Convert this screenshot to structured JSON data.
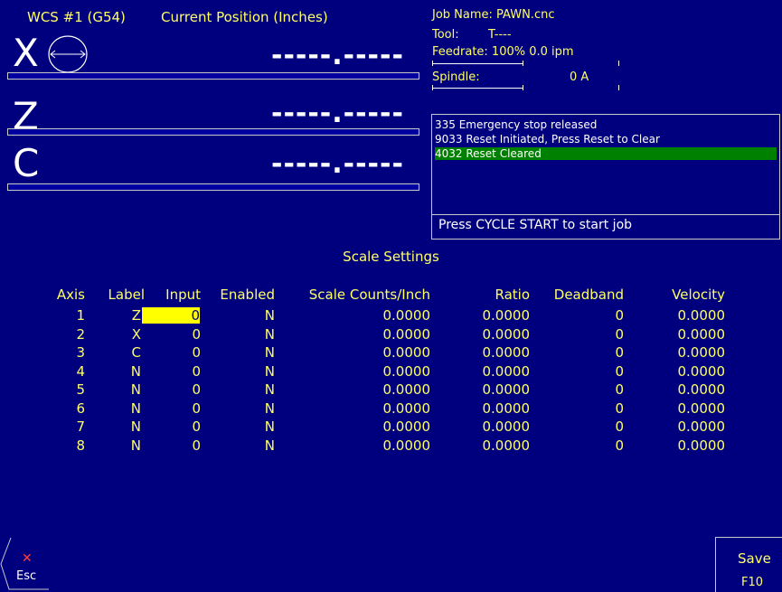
{
  "header": {
    "wcs": "WCS #1 (G54)",
    "position_title": "Current Position (Inches)"
  },
  "axes": [
    {
      "letter": "X",
      "value": "-----.-----",
      "has_diameter_icon": true
    },
    {
      "letter": "Z",
      "value": "-----.-----",
      "has_diameter_icon": false
    },
    {
      "letter": "C",
      "value": "-----.-----",
      "has_diameter_icon": false
    }
  ],
  "job": {
    "name_line": "Job Name: PAWN.cnc",
    "tool_label": "Tool:",
    "tool_value": "T----",
    "feedrate_line": "Feedrate: 100%  0.0 ipm",
    "spindle_label": "Spindle:",
    "spindle_value": "0  A"
  },
  "messages": [
    {
      "text": "335 Emergency stop released",
      "highlight": false
    },
    {
      "text": "9033 Reset Initiated, Press Reset to Clear",
      "highlight": false
    },
    {
      "text": "4032 Reset Cleared",
      "highlight": true
    }
  ],
  "prompt": "Press CYCLE START to start job",
  "scale": {
    "title": "Scale Settings",
    "columns": [
      "Axis",
      "Label",
      "Input",
      "Enabled",
      "Scale Counts/Inch",
      "Ratio",
      "Deadband",
      "Velocity"
    ],
    "rows": [
      [
        "1",
        "Z",
        "0",
        "N",
        "0.0000",
        "0.0000",
        "0",
        "0.0000"
      ],
      [
        "2",
        "X",
        "0",
        "N",
        "0.0000",
        "0.0000",
        "0",
        "0.0000"
      ],
      [
        "3",
        "C",
        "0",
        "N",
        "0.0000",
        "0.0000",
        "0",
        "0.0000"
      ],
      [
        "4",
        "N",
        "0",
        "N",
        "0.0000",
        "0.0000",
        "0",
        "0.0000"
      ],
      [
        "5",
        "N",
        "0",
        "N",
        "0.0000",
        "0.0000",
        "0",
        "0.0000"
      ],
      [
        "6",
        "N",
        "0",
        "N",
        "0.0000",
        "0.0000",
        "0",
        "0.0000"
      ],
      [
        "7",
        "N",
        "0",
        "N",
        "0.0000",
        "0.0000",
        "0",
        "0.0000"
      ],
      [
        "8",
        "N",
        "0",
        "N",
        "0.0000",
        "0.0000",
        "0",
        "0.0000"
      ]
    ],
    "selected_row": 0,
    "selected_col": 2
  },
  "softkeys": {
    "esc_icon": "x-icon",
    "esc_label": "Esc",
    "save_label": "Save",
    "save_key": "F10"
  },
  "colors": {
    "background": "#00007f",
    "text": "#ffff66",
    "highlight_message": "#008000",
    "selected_cell": "#ffff00"
  }
}
